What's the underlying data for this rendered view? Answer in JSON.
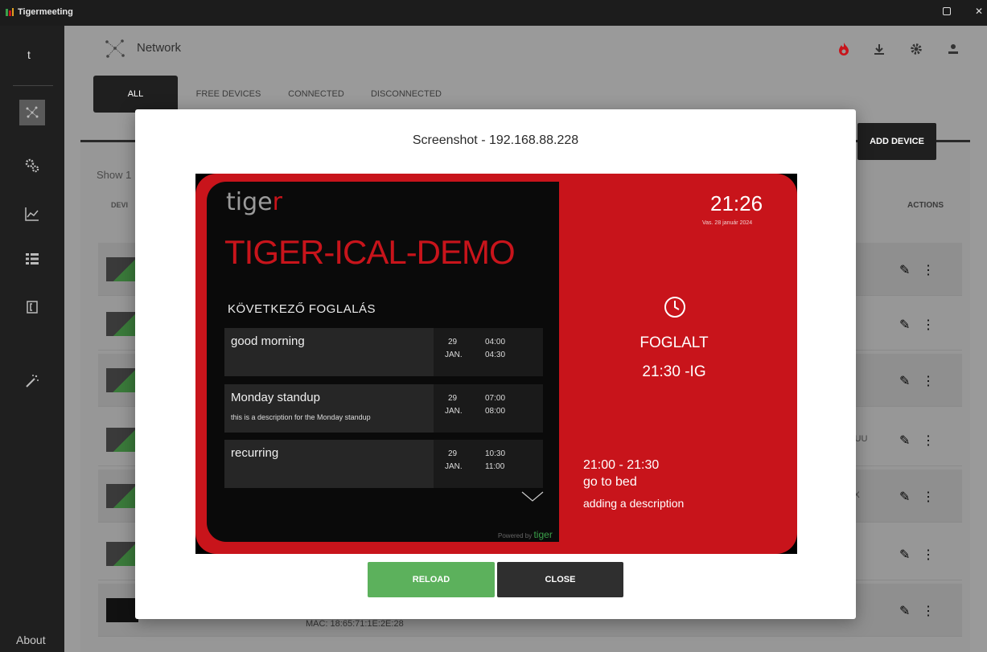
{
  "window": {
    "title": "Tigermeeting"
  },
  "sidebar": {
    "brand": "t",
    "about": "About"
  },
  "header": {
    "title": "Network"
  },
  "tabs": [
    {
      "label": "ALL"
    },
    {
      "label": "FREE DEVICES"
    },
    {
      "label": "CONNECTED"
    },
    {
      "label": "DISCONNECTED"
    }
  ],
  "toolbar": {
    "add_device": "ADD DEVICE"
  },
  "table": {
    "show_label": "Show 1",
    "col_device": "DEVI",
    "col_actions": "ACTIONS",
    "rows": [
      {
        "extra": ""
      },
      {
        "extra": ""
      },
      {
        "extra": ""
      },
      {
        "extra": "J:UU"
      },
      {
        "extra": "XX"
      },
      {
        "extra": ":)"
      },
      {
        "extra": ""
      }
    ],
    "mac_text": "MAC: 18:65:71:1E:2E:28"
  },
  "modal": {
    "title": "Screenshot - 192.168.88.228",
    "reload": "RELOAD",
    "close": "CLOSE"
  },
  "screen": {
    "logo_a": "tige",
    "logo_b": "r",
    "room": "TIGER-ICAL-DEMO",
    "next_label": "KÖVETKEZŐ FOGLALÁS",
    "events": [
      {
        "title": "good morning",
        "desc": "",
        "day": "29",
        "month": "JAN.",
        "start": "04:00",
        "end": "04:30"
      },
      {
        "title": "Monday standup",
        "desc": "this is a description for the Monday standup",
        "day": "29",
        "month": "JAN.",
        "start": "07:00",
        "end": "08:00"
      },
      {
        "title": "recurring",
        "desc": "",
        "day": "29",
        "month": "JAN.",
        "start": "10:30",
        "end": "11:00"
      }
    ],
    "clock": "21:26",
    "date": "Vas. 28 január 2024",
    "status": "FOGLALT",
    "until": "21:30 -IG",
    "current_time": "21:00 - 21:30",
    "current_title": "go to bed",
    "current_desc": "adding a description",
    "powered_a": "Powered by ",
    "powered_b": "tiger"
  },
  "colors": {
    "accent_red": "#c8141b",
    "reload_green": "#5cb15c",
    "dark": "#1f1f1f"
  }
}
